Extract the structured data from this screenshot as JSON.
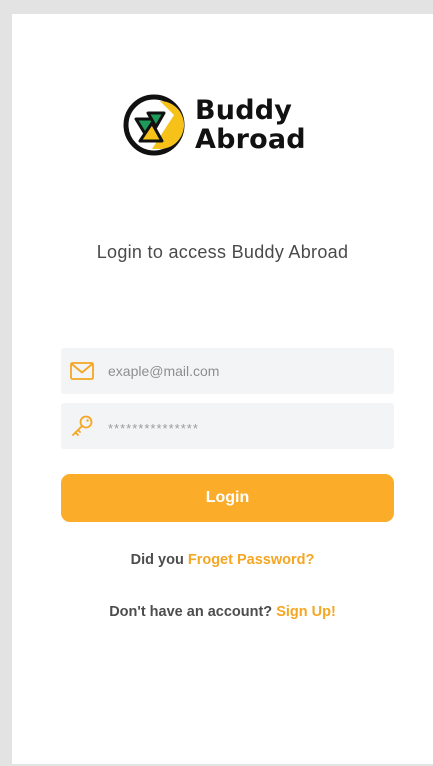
{
  "logo": {
    "line1": "Buddy",
    "line2": "Abroad"
  },
  "subtitle": "Login to access Buddy Abroad",
  "email_field": {
    "value": "exaple@mail.com",
    "icon": "mail-icon"
  },
  "password_field": {
    "value": "***************",
    "icon": "key-icon"
  },
  "login_button": {
    "label": "Login"
  },
  "forgot": {
    "prefix": "Did you ",
    "link": "Froget Password?"
  },
  "signup": {
    "prefix": "Don't have an account? ",
    "link": "Sign Up!"
  },
  "colors": {
    "accent": "#fbad2a",
    "logo_yellow": "#f6c21a",
    "logo_green": "#1e9a5a"
  }
}
